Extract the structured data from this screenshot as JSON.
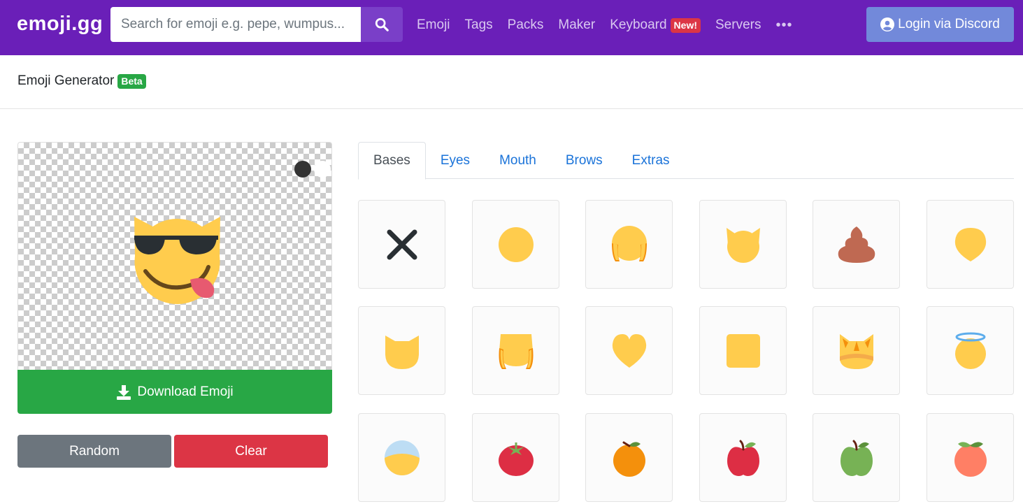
{
  "brand": "emoji.gg",
  "search": {
    "placeholder": "Search for emoji e.g. pepe, wumpus..."
  },
  "nav": {
    "links": [
      "Emoji",
      "Tags",
      "Packs",
      "Maker",
      "Keyboard",
      "Servers"
    ],
    "keyboard_badge": "New!",
    "more": "•••"
  },
  "login": {
    "label": "Login via Discord"
  },
  "page": {
    "title": "Emoji Generator",
    "badge": "Beta"
  },
  "actions": {
    "download": "Download Emoji",
    "random": "Random",
    "clear": "Clear"
  },
  "tabs": [
    "Bases",
    "Eyes",
    "Mouth",
    "Brows",
    "Extras"
  ],
  "active_tab": "Bases",
  "colors": {
    "navbar": "#6a1fb8",
    "discord": "#7289da",
    "success": "#28a745",
    "danger": "#dc3545",
    "secondary": "#6c757d",
    "link": "#1a73d9",
    "emoji_yellow": "#ffcc4d"
  },
  "preview": {
    "icon": "cool-cat-tongue-emoji"
  },
  "bases": [
    "none-x-icon",
    "round-face-icon",
    "hair-face-icon",
    "horned-face-icon",
    "poop-icon",
    "drop-face-icon",
    "cat-face-icon",
    "long-hair-face-icon",
    "heart-face-icon",
    "square-face-icon",
    "fox-face-icon",
    "halo-face-icon",
    "moon-face-icon",
    "tomato-icon",
    "orange-icon",
    "apple-icon",
    "green-apple-icon",
    "peach-icon"
  ]
}
